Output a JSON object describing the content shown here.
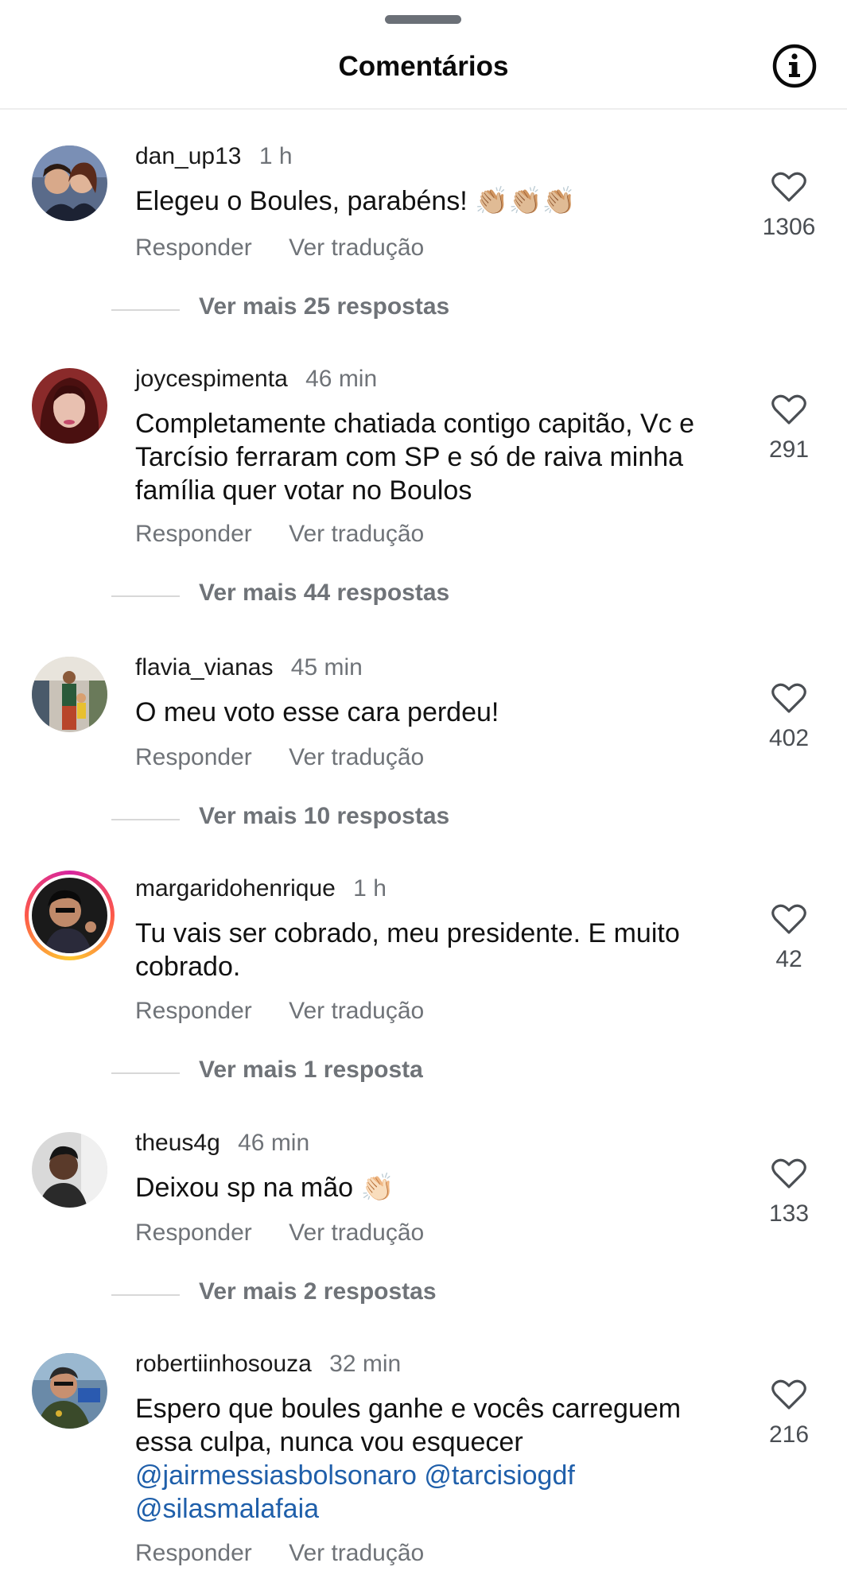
{
  "header": {
    "title": "Comentários",
    "info_icon": "info-icon"
  },
  "comments": [
    {
      "username": "dan_up13",
      "time": "1 h",
      "text": "Elegeu o Boules, parabéns! 👏🏼👏🏼👏🏼",
      "reply_label": "Responder",
      "translate_label": "Ver tradução",
      "likes": "1306",
      "replies": "Ver mais 25 respostas"
    },
    {
      "username": "joycespimenta",
      "time": "46 min",
      "text": "Completamente chatiada contigo capitão, Vc e Tarcísio ferraram com SP e só de raiva minha família quer votar no Boulos",
      "reply_label": "Responder",
      "translate_label": "Ver tradução",
      "likes": "291",
      "replies": "Ver mais 44 respostas"
    },
    {
      "username": "flavia_vianas",
      "time": "45 min",
      "text": "O meu voto esse cara perdeu!",
      "reply_label": "Responder",
      "translate_label": "Ver tradução",
      "likes": "402",
      "replies": "Ver mais 10 respostas"
    },
    {
      "username": "margaridohenrique",
      "time": "1 h",
      "text": "Tu vais ser cobrado, meu presidente. E muito cobrado.",
      "reply_label": "Responder",
      "translate_label": "Ver tradução",
      "likes": "42",
      "replies": "Ver mais 1 resposta"
    },
    {
      "username": "theus4g",
      "time": "46 min",
      "text": "Deixou sp na mão 👏🏻",
      "reply_label": "Responder",
      "translate_label": "Ver tradução",
      "likes": "133",
      "replies": "Ver mais 2 respostas"
    },
    {
      "username": "robertiinhosouza",
      "time": "32 min",
      "text": "Espero que boules ganhe e vocês carreguem essa culpa, nunca vou esquecer",
      "mentions": [
        "@jairmessiasbolsonaro",
        "@tarcisiogdf",
        "@silasmalafaia"
      ],
      "reply_label": "Responder",
      "translate_label": "Ver tradução",
      "likes": "216"
    }
  ],
  "colors": {
    "mention": "#1f5faa",
    "muted": "#6f7378",
    "story_ring": "#d6249f"
  }
}
